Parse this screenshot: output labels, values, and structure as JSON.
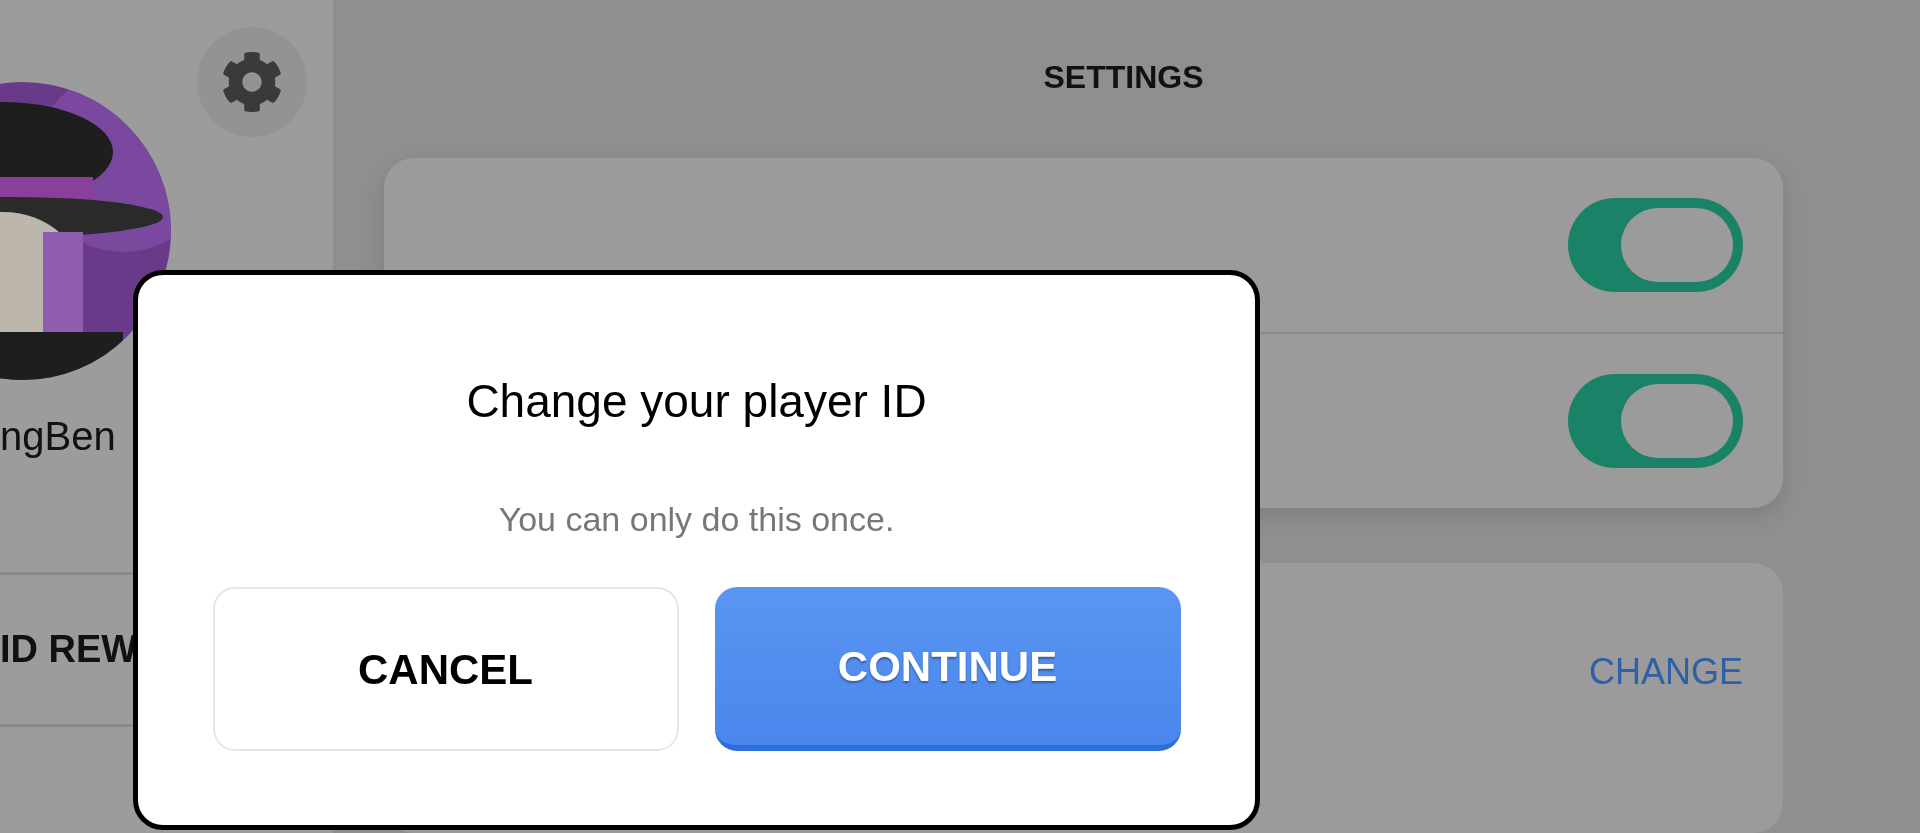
{
  "sidebar": {
    "username": "ngBen",
    "menu_items": [
      {
        "label": "ID REW"
      }
    ]
  },
  "header": {
    "title": "SETTINGS"
  },
  "toggles": [
    {
      "on": true
    },
    {
      "on": true
    }
  ],
  "player_id": {
    "action": "CHANGE"
  },
  "dialog": {
    "title": "Change your player ID",
    "message": "You can only do this once.",
    "buttons": [
      {
        "label": "CANCEL",
        "kind": "secondary"
      },
      {
        "label": "CONTINUE",
        "kind": "primary"
      }
    ]
  }
}
